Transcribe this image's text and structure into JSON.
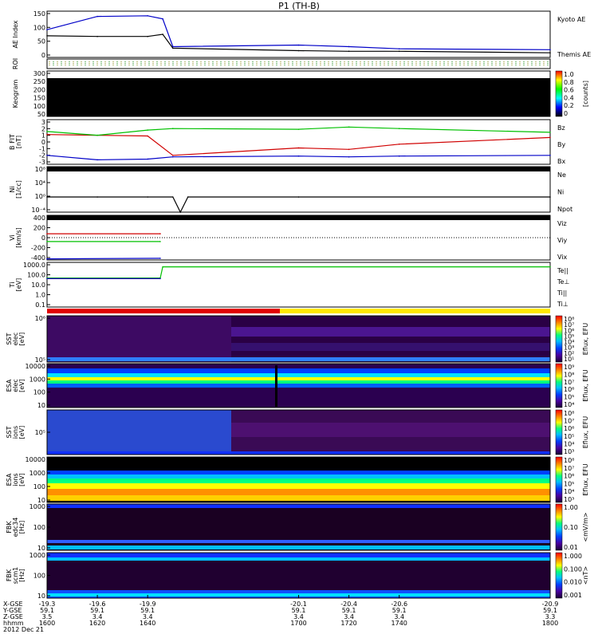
{
  "title": "P1 (TH-B)",
  "x_ticks": {
    "x_gse": [
      "-19.3",
      "-19.6",
      "-19.9",
      "-20.1",
      "-20.4",
      "-20.6",
      "-20.9"
    ],
    "y_gse": [
      "59.1",
      "59.1",
      "59.1",
      "59.1",
      "59.1",
      "59.1",
      "59.1"
    ],
    "z_gse": [
      "3.5",
      "3.4",
      "3.4",
      "3.4",
      "3.4",
      "3.4",
      "3.3"
    ],
    "hhmm": [
      "1600",
      "1620",
      "1640",
      "1700",
      "1720",
      "1740",
      "1800"
    ]
  },
  "x_row_labels": [
    "X-GSE",
    "Y-GSE",
    "Z-GSE",
    "hhmm",
    "2012 Dec 21"
  ],
  "panels": [
    {
      "id": "ae",
      "ylabel": [
        "AE Index"
      ],
      "ticks": [
        "150",
        "100",
        "50",
        "0"
      ],
      "legend": [
        {
          "text": "Kyoto AE",
          "color": "#0000c8"
        },
        {
          "text": "Themis AE",
          "color": "#000000"
        }
      ]
    },
    {
      "id": "roi",
      "ylabel": [
        "ROI"
      ],
      "ticks": [],
      "legend": []
    },
    {
      "id": "keogram",
      "ylabel": [
        "Keogram"
      ],
      "ticks": [
        "300",
        "250",
        "200",
        "150",
        "100",
        "50"
      ],
      "legend": [],
      "colorbar": {
        "ticks": [
          "1.0",
          "0.8",
          "0.6",
          "0.4",
          "0.2",
          "0"
        ],
        "label": "[counts]"
      }
    },
    {
      "id": "bfit",
      "ylabel": [
        "B FIT",
        "[nT]"
      ],
      "ticks": [
        "3",
        "2",
        "1",
        "0",
        "-1",
        "-2",
        "-3"
      ],
      "legend": [
        {
          "text": "Bz",
          "color": "#d00000"
        },
        {
          "text": "By",
          "color": "#00c000"
        },
        {
          "text": "Bx",
          "color": "#0000c8"
        }
      ]
    },
    {
      "id": "ni",
      "ylabel": [
        "Ni",
        "[1/cc]"
      ],
      "ticks": [
        "10⁸",
        "10⁴",
        "10⁰",
        "10⁻⁴"
      ],
      "legend": [
        {
          "text": "Ne",
          "color": "#d00000"
        },
        {
          "text": "Ni",
          "color": "#000000"
        },
        {
          "text": "Npot",
          "color": "#0000c8"
        }
      ]
    },
    {
      "id": "vi",
      "ylabel": [
        "Vi",
        "[km/s]"
      ],
      "ticks": [
        "400",
        "200",
        "0",
        "-200",
        "-400"
      ],
      "legend": [
        {
          "text": "Viz",
          "color": "#d00000"
        },
        {
          "text": "Viy",
          "color": "#00c000"
        },
        {
          "text": "Vix",
          "color": "#0000c8"
        }
      ]
    },
    {
      "id": "ti",
      "ylabel": [
        "Ti",
        "[eV]"
      ],
      "ticks": [
        "1000.0",
        "100.0",
        "10.0",
        "1.0",
        "0.1"
      ],
      "legend": [
        {
          "text": "Te||",
          "color": "#000000"
        },
        {
          "text": "Te⊥",
          "color": "#d00000"
        },
        {
          "text": "Ti||",
          "color": "#00c000"
        },
        {
          "text": "Ti⊥",
          "color": "#0000c8"
        }
      ]
    },
    {
      "id": "sst_e",
      "ylabel": [
        "SST",
        "elec",
        "[eV]"
      ],
      "ticks": [
        "10⁶",
        "10⁵"
      ],
      "legend": [],
      "colorbar": {
        "ticks": [
          "10⁸",
          "10⁷",
          "10⁶",
          "10⁵",
          "10⁴",
          "10³",
          "10²",
          "10¹"
        ],
        "label": "Eflux, EFU"
      }
    },
    {
      "id": "esa_e",
      "ylabel": [
        "ESA",
        "elec",
        "[eV]"
      ],
      "ticks": [
        "10000",
        "1000",
        "100",
        "10"
      ],
      "legend": [],
      "colorbar": {
        "ticks": [
          "10⁹",
          "10⁸",
          "10⁷",
          "10⁶",
          "10⁵",
          "10⁴"
        ],
        "label": "Eflux, EFU"
      }
    },
    {
      "id": "sst_i",
      "ylabel": [
        "SST",
        "ions",
        "[eV]"
      ],
      "ticks": [
        "10⁵"
      ],
      "legend": [],
      "colorbar": {
        "ticks": [
          "10⁸",
          "10⁷",
          "10⁶",
          "10⁵",
          "10⁴",
          "10³"
        ],
        "label": "Eflux, EFU"
      }
    },
    {
      "id": "esa_i",
      "ylabel": [
        "ESA",
        "ions",
        "[eV]"
      ],
      "ticks": [
        "10000",
        "1000",
        "100",
        "10"
      ],
      "legend": [],
      "colorbar": {
        "ticks": [
          "10⁸",
          "10⁷",
          "10⁶",
          "10⁵",
          "10⁴",
          "10³"
        ],
        "label": "Eflux, EFU"
      }
    },
    {
      "id": "fbk_e",
      "ylabel": [
        "FBK",
        "edc34",
        "[Hz]"
      ],
      "ticks": [
        "1000",
        "100",
        "10"
      ],
      "legend": [],
      "colorbar": {
        "ticks": [
          "1.00",
          "0.10",
          "0.01"
        ],
        "label": "<mV/m>"
      }
    },
    {
      "id": "fbk_b",
      "ylabel": [
        "FBK",
        "scm1",
        "[Hz]"
      ],
      "ticks": [
        "1000",
        "100",
        "10"
      ],
      "legend": [],
      "colorbar": {
        "ticks": [
          "1.000",
          "0.100",
          "0.010",
          "0.001"
        ],
        "label": "<nT>"
      }
    }
  ],
  "chart_data": [
    {
      "type": "line",
      "panel": "AE Index",
      "x": [
        1600,
        1620,
        1640,
        1646,
        1650,
        1700,
        1720,
        1740,
        1800
      ],
      "ylim": [
        0,
        150
      ],
      "series": [
        {
          "name": "Kyoto AE",
          "color": "#0000c8",
          "values": [
            90,
            133,
            135,
            125,
            35,
            40,
            35,
            28,
            25
          ]
        },
        {
          "name": "Themis AE",
          "color": "#000000",
          "values": [
            70,
            68,
            68,
            75,
            30,
            22,
            20,
            20,
            15
          ]
        }
      ]
    },
    {
      "type": "heatmap",
      "panel": "Keogram",
      "ylim": [
        0,
        300
      ],
      "value": "no data (black)"
    },
    {
      "type": "line",
      "panel": "B FIT",
      "x": [
        1600,
        1620,
        1640,
        1650,
        1700,
        1720,
        1740,
        1800
      ],
      "ylim": [
        -3,
        3
      ],
      "series": [
        {
          "name": "Bz",
          "color": "#d00000",
          "values": [
            1.0,
            0.9,
            0.8,
            -1.8,
            -0.8,
            -1.0,
            -0.3,
            0.6
          ]
        },
        {
          "name": "By",
          "color": "#00c000",
          "values": [
            1.4,
            0.9,
            1.6,
            1.8,
            1.7,
            2.0,
            1.8,
            1.3
          ]
        },
        {
          "name": "Bx",
          "color": "#0000c8",
          "values": [
            -1.8,
            -2.4,
            -2.3,
            -2.0,
            -1.9,
            -2.0,
            -1.9,
            -1.8
          ]
        }
      ]
    },
    {
      "type": "line",
      "panel": "Ni",
      "x": [
        1600,
        1620,
        1640,
        1650,
        1653,
        1656,
        1700,
        1800
      ],
      "ylim": [
        "1e-4",
        "1e8"
      ],
      "series": [
        {
          "name": "Ni",
          "color": "#000000",
          "values": [
            "1e0",
            "1e0",
            "1e0",
            "1e0",
            "1e-4",
            "1e0",
            "1e0",
            "1e0"
          ]
        }
      ]
    },
    {
      "type": "line",
      "panel": "Vi",
      "x": [
        1600,
        1645
      ],
      "ylim": [
        -400,
        400
      ],
      "series": [
        {
          "name": "Viz",
          "color": "#d00000",
          "values": [
            70,
            70
          ]
        },
        {
          "name": "Viy",
          "color": "#00c000",
          "values": [
            -70,
            -70
          ]
        },
        {
          "name": "Vix",
          "color": "#0000c8",
          "values": [
            -380,
            -370
          ]
        }
      ]
    },
    {
      "type": "line",
      "panel": "Ti",
      "x": [
        1600,
        1645,
        1646,
        1800
      ],
      "ylim": [
        0.1,
        1000
      ],
      "series": [
        {
          "name": "Ti||",
          "color": "#00c000",
          "values": [
            40,
            40,
            400,
            400
          ]
        },
        {
          "name": "Ti⊥",
          "color": "#0000c8",
          "values": [
            35,
            35,
            null,
            null
          ]
        }
      ]
    },
    {
      "type": "heatmap",
      "panel": "SST elec",
      "ylim": [
        "1e4",
        "1e6"
      ],
      "value": "purple / dark noise; change at 1645"
    },
    {
      "type": "heatmap",
      "panel": "ESA elec",
      "ylim": [
        10,
        10000
      ],
      "value": "bright band near 1000 eV"
    },
    {
      "type": "heatmap",
      "panel": "SST ions",
      "ylim": [
        "1e4",
        "1e6"
      ],
      "value": "blue/purple noise before 1645, dark after"
    },
    {
      "type": "heatmap",
      "panel": "ESA ions",
      "ylim": [
        10,
        10000
      ],
      "value": "broad band 10-1000 eV"
    },
    {
      "type": "heatmap",
      "panel": "FBK edc34",
      "ylim": [
        1,
        1000
      ],
      "value": "bands near 1000 and 3 Hz"
    },
    {
      "type": "heatmap",
      "panel": "FBK scm1",
      "ylim": [
        1,
        1000
      ],
      "value": "bands near 1000 and 1 Hz"
    }
  ]
}
